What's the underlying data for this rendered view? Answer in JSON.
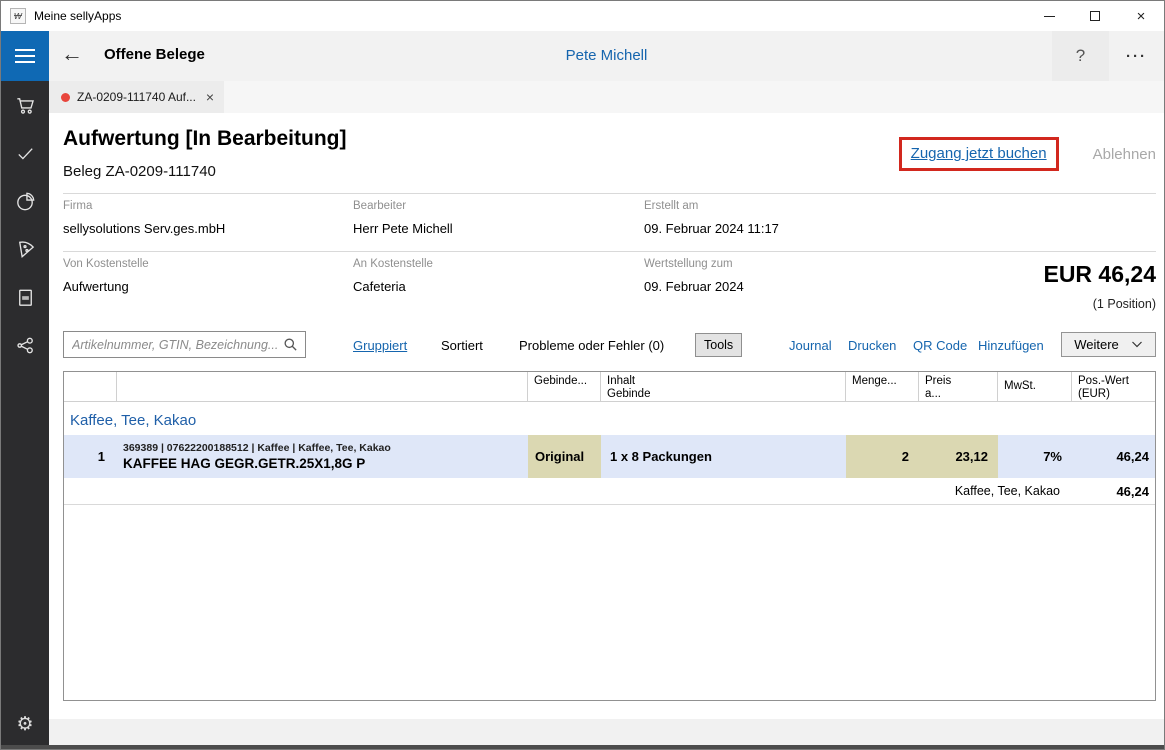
{
  "window": {
    "title": "Meine sellyApps",
    "app_icon_glyph": "w",
    "controls": {
      "minimize": "",
      "maximize": "",
      "close": "×"
    }
  },
  "header": {
    "back_glyph": "←",
    "title": "Offene Belege",
    "user": "Pete Michell",
    "help_glyph": "?",
    "more_glyph": "···"
  },
  "sidebar": {
    "icons": [
      "cart-icon",
      "checkmark-icon",
      "pie-chart-icon",
      "pizza-slice-icon",
      "book-icon",
      "share-network-icon",
      "gear-icon"
    ],
    "gear_glyph": "⚙"
  },
  "tab": {
    "label": "ZA-0209-111740 Auf...",
    "close_glyph": "×",
    "modified_dot_color": "#e8453c"
  },
  "document": {
    "title": "Aufwertung [In Bearbeitung]",
    "subtitle": "Beleg ZA-0209-111740",
    "actions": {
      "primary": "Zugang jetzt buchen",
      "secondary": "Ablehnen"
    },
    "meta_row1": [
      {
        "label": "Firma",
        "value": "sellysolutions Serv.ges.mbH"
      },
      {
        "label": "Bearbeiter",
        "value": "Herr Pete Michell"
      },
      {
        "label": "Erstellt am",
        "value": "09. Februar 2024 11:17"
      }
    ],
    "meta_row2": [
      {
        "label": "Von Kostenstelle",
        "value": "Aufwertung"
      },
      {
        "label": "An Kostenstelle",
        "value": "Cafeteria"
      },
      {
        "label": "Wertstellung zum",
        "value": "09. Februar 2024"
      }
    ],
    "total": {
      "amount": "EUR 46,24",
      "positions": "(1 Position)"
    }
  },
  "toolbar": {
    "search_placeholder": "Artikelnummer, GTIN, Bezeichnung...",
    "grouped": "Gruppiert",
    "sorted": "Sortiert",
    "problems": "Probleme oder Fehler (0)",
    "tools": "Tools",
    "links": [
      "Journal",
      "Drucken",
      "QR Code",
      "Hinzufügen"
    ],
    "more": "Weitere"
  },
  "table": {
    "columns": [
      "",
      "",
      "Gebinde...",
      "Inhalt\nGebinde",
      "Menge...",
      "Preis\na...",
      "MwSt.",
      "Pos.-Wert\n(EUR)"
    ],
    "group": "Kaffee, Tee, Kakao",
    "rows": [
      {
        "num": "1",
        "info": "369389 | 07622200188512 | Kaffee | Kaffee, Tee, Kakao",
        "name": "KAFFEE HAG GEGR.GETR.25X1,8G P",
        "gebinde": "Original",
        "inhalt": "1 x 8 Packungen",
        "menge": "2",
        "preis": "23,12",
        "mwst": "7%",
        "wert": "46,24"
      }
    ],
    "summary": {
      "group": "Kaffee, Tee, Kakao",
      "wert": "46,24"
    }
  },
  "colors": {
    "accent_blue": "#0f69b4",
    "link_blue": "#1565ae",
    "highlight_red": "#d2281e",
    "row_blue": "#dfe7f8",
    "editable_beige": "#dbd8b2",
    "sidebar_dark": "#2c2c2e",
    "tab_dot_red": "#e8453c"
  }
}
